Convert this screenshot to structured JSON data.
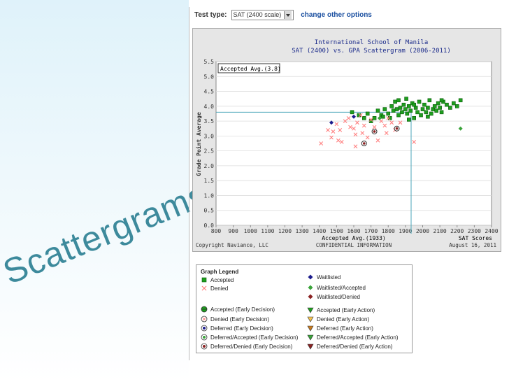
{
  "slide": {
    "title": "Scattergrams"
  },
  "toolbar": {
    "test_type_label": "Test type:",
    "test_type_value": "SAT (2400 scale)",
    "change_link": "change other options"
  },
  "colors": {
    "accepted": "#1e9e1e",
    "denied": "#ff7f7f",
    "waitlisted": "#1c1c8c",
    "wl_accepted": "#3aa33a",
    "wl_denied": "#8b2222",
    "avg_line": "#4aa6b8"
  },
  "chart": {
    "title_line1": "International School of Manila",
    "title_line2": "SAT (2400) vs. GPA Scattergram (2006-2011)",
    "ylabel": "Grade Point Average",
    "avg_box": "Accepted Avg.(3.8)",
    "x_avg_label": "Accepted Avg.(1933)",
    "x_title": "SAT Scores",
    "copyright": "Copyright Naviance, LLC",
    "confidential": "CONFIDENTIAL INFORMATION",
    "date": "August 16, 2011"
  },
  "chart_data": {
    "type": "scatter",
    "title": "International School of Manila SAT (2400) vs. GPA Scattergram (2006-2011)",
    "xlabel": "SAT Scores",
    "ylabel": "Grade Point Average",
    "xlim": [
      800,
      2400
    ],
    "ylim": [
      0,
      5.5
    ],
    "xticks": [
      800,
      900,
      1000,
      1100,
      1200,
      1300,
      1400,
      1500,
      1600,
      1700,
      1800,
      1900,
      2000,
      2100,
      2200,
      2300,
      2400
    ],
    "yticks": [
      0.0,
      0.5,
      1.0,
      1.5,
      2.0,
      2.5,
      3.0,
      3.5,
      4.0,
      4.5,
      5.0,
      5.5
    ],
    "avg_x": 1933,
    "avg_y": 3.8,
    "series": [
      {
        "name": "Accepted",
        "marker": "square",
        "points": [
          [
            1590,
            3.8
          ],
          [
            1630,
            3.7
          ],
          [
            1660,
            3.6
          ],
          [
            1680,
            3.75
          ],
          [
            1700,
            3.5
          ],
          [
            1720,
            3.6
          ],
          [
            1740,
            3.85
          ],
          [
            1760,
            3.7
          ],
          [
            1780,
            3.9
          ],
          [
            1800,
            3.75
          ],
          [
            1810,
            3.6
          ],
          [
            1820,
            4.0
          ],
          [
            1830,
            3.85
          ],
          [
            1840,
            4.15
          ],
          [
            1850,
            3.9
          ],
          [
            1860,
            3.7
          ],
          [
            1870,
            3.95
          ],
          [
            1880,
            3.8
          ],
          [
            1890,
            4.05
          ],
          [
            1900,
            3.9
          ],
          [
            1905,
            4.25
          ],
          [
            1910,
            3.75
          ],
          [
            1920,
            4.0
          ],
          [
            1930,
            3.85
          ],
          [
            1940,
            4.1
          ],
          [
            1950,
            3.6
          ],
          [
            1960,
            3.95
          ],
          [
            1970,
            3.8
          ],
          [
            1980,
            4.15
          ],
          [
            1990,
            3.7
          ],
          [
            2000,
            3.9
          ],
          [
            2010,
            4.05
          ],
          [
            2020,
            3.8
          ],
          [
            2030,
            3.95
          ],
          [
            2040,
            4.2
          ],
          [
            2050,
            3.75
          ],
          [
            2060,
            3.9
          ],
          [
            2070,
            4.0
          ],
          [
            2080,
            3.85
          ],
          [
            2090,
            4.1
          ],
          [
            2100,
            3.95
          ],
          [
            2110,
            3.8
          ],
          [
            2120,
            4.15
          ],
          [
            2140,
            4.05
          ],
          [
            2160,
            3.95
          ],
          [
            2180,
            4.1
          ],
          [
            2200,
            4.0
          ],
          [
            2220,
            4.2
          ],
          [
            1770,
            3.65
          ],
          [
            1860,
            4.2
          ],
          [
            1950,
            4.05
          ],
          [
            2030,
            3.65
          ],
          [
            1920,
            3.55
          ],
          [
            2110,
            4.2
          ]
        ]
      },
      {
        "name": "Denied",
        "marker": "x",
        "points": [
          [
            1410,
            2.75
          ],
          [
            1450,
            3.2
          ],
          [
            1470,
            2.95
          ],
          [
            1480,
            3.15
          ],
          [
            1500,
            3.4
          ],
          [
            1510,
            2.85
          ],
          [
            1520,
            3.2
          ],
          [
            1530,
            2.8
          ],
          [
            1550,
            3.5
          ],
          [
            1570,
            3.6
          ],
          [
            1580,
            3.3
          ],
          [
            1600,
            3.25
          ],
          [
            1610,
            2.65
          ],
          [
            1620,
            3.45
          ],
          [
            1640,
            3.7
          ],
          [
            1650,
            3.1
          ],
          [
            1660,
            3.35
          ],
          [
            1680,
            2.95
          ],
          [
            1700,
            3.55
          ],
          [
            1720,
            3.3
          ],
          [
            1740,
            2.85
          ],
          [
            1760,
            3.5
          ],
          [
            1780,
            3.35
          ],
          [
            1800,
            3.6
          ],
          [
            1820,
            3.45
          ],
          [
            1840,
            3.2
          ],
          [
            1870,
            3.45
          ],
          [
            1950,
            2.8
          ],
          [
            1610,
            3.05
          ],
          [
            1790,
            3.1
          ]
        ]
      },
      {
        "name": "Waitlisted",
        "marker": "diamond",
        "points": [
          [
            1470,
            3.45
          ],
          [
            1600,
            3.65
          ]
        ]
      },
      {
        "name": "Waitlisted/Accepted",
        "marker": "diamond",
        "points": [
          [
            2220,
            3.25
          ],
          [
            1750,
            3.6
          ]
        ]
      },
      {
        "name": "Deferred/Denied (Early Decision)",
        "marker": "circle",
        "points": [
          [
            1660,
            2.75
          ],
          [
            1720,
            3.15
          ],
          [
            1850,
            3.25
          ]
        ]
      }
    ]
  },
  "legend": {
    "title": "Graph Legend",
    "items": [
      "Accepted",
      "Denied",
      "Waitlisted",
      "Waitlisted/Accepted",
      "Waitlisted/Denied",
      "Accepted (Early Decision)",
      "Denied (Early Decision)",
      "Deferred (Early Decision)",
      "Deferred/Accepted (Early Decision)",
      "Deferred/Denied (Early Decision)",
      "Accepted (Early Action)",
      "Denied (Early Action)",
      "Deferred (Early Action)",
      "Deferred/Accepted (Early Action)",
      "Deferred/Denied (Early Action)"
    ]
  }
}
